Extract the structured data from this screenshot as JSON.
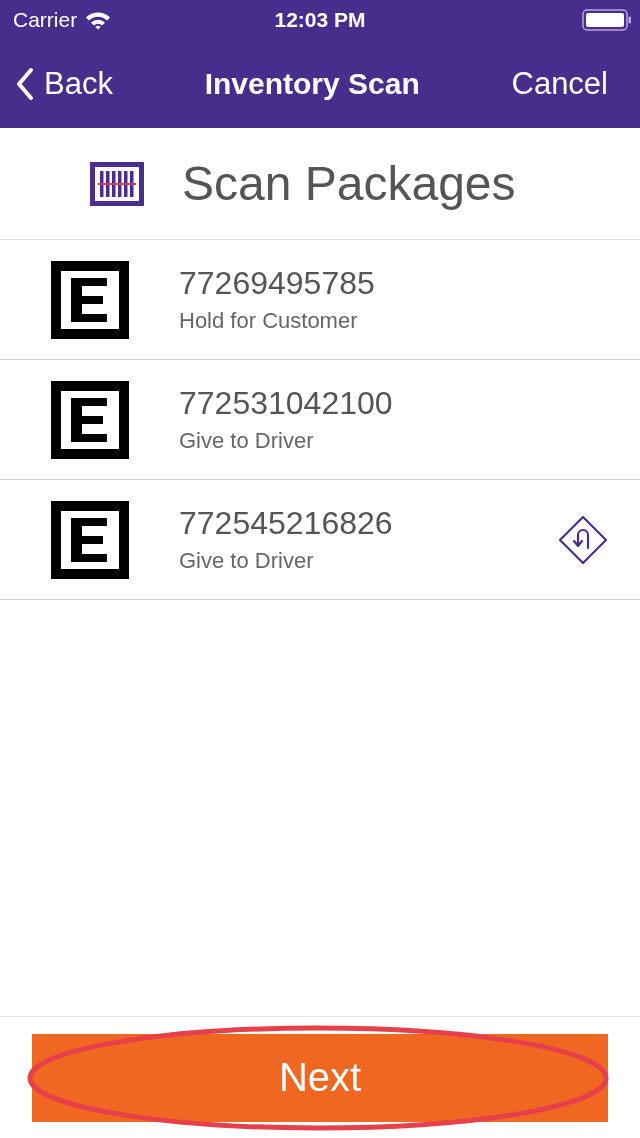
{
  "status_bar": {
    "carrier": "Carrier",
    "time": "12:03 PM"
  },
  "nav": {
    "back": "Back",
    "title": "Inventory Scan",
    "cancel": "Cancel"
  },
  "header": {
    "title": "Scan Packages"
  },
  "packages": [
    {
      "number": "77269495785",
      "status": "Hold for Customer",
      "return_marker": false
    },
    {
      "number": "772531042100",
      "status": "Give to Driver",
      "return_marker": false
    },
    {
      "number": "772545216826",
      "status": "Give to Driver",
      "return_marker": true
    }
  ],
  "footer": {
    "button": "Next",
    "highlighted": true
  }
}
